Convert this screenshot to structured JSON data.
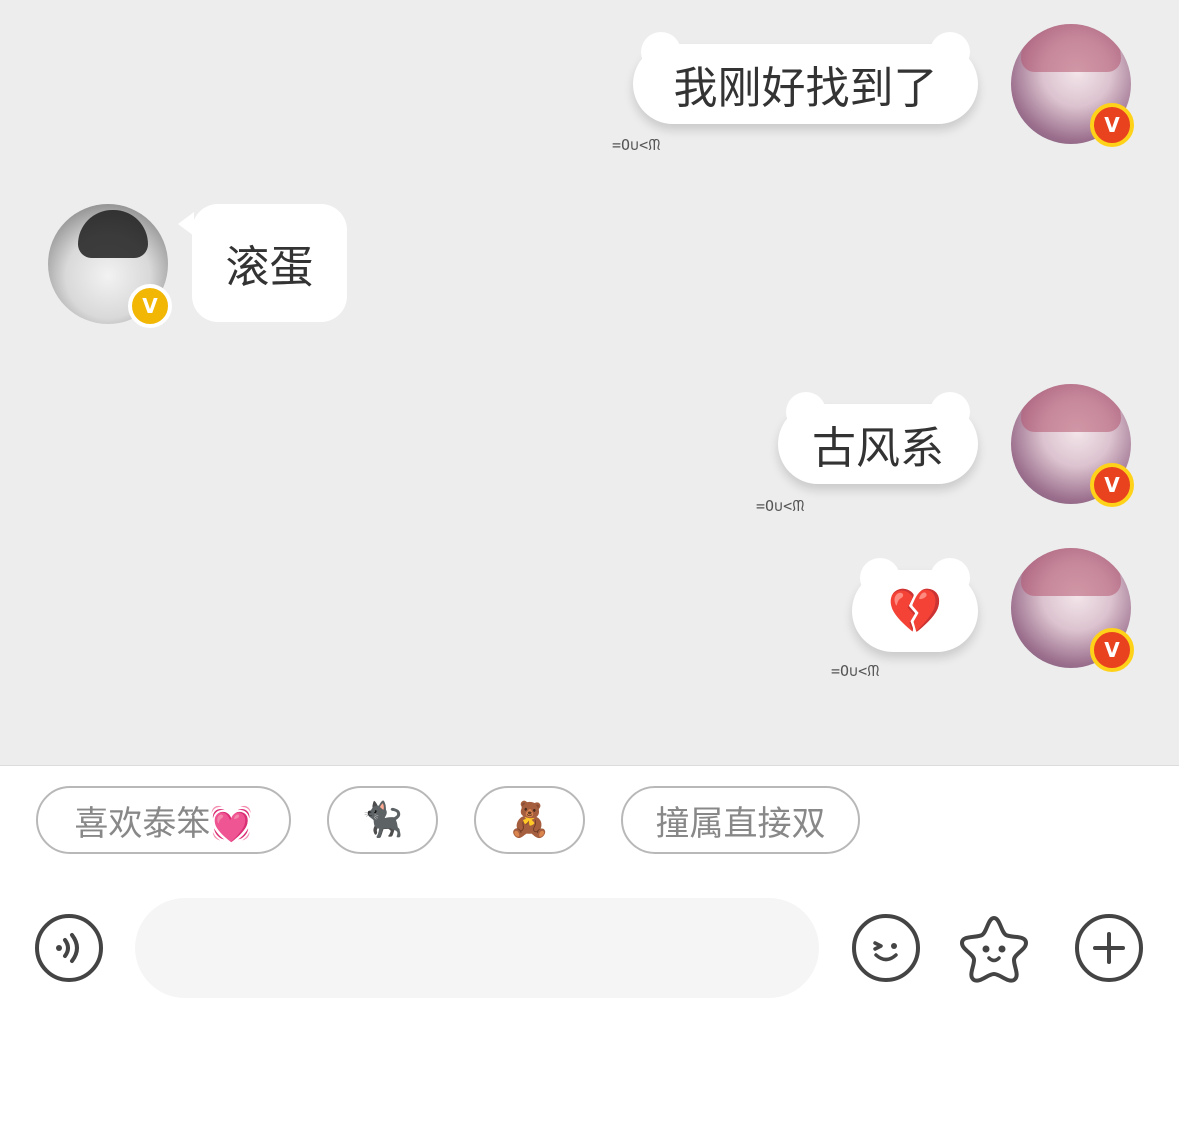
{
  "messages": [
    {
      "text": "我刚好找到了",
      "meta": "=O∪<ᙏ"
    },
    {
      "text": "滚蛋"
    },
    {
      "text": "古风系",
      "meta": "=O∪<ᙏ"
    },
    {
      "text": "💔",
      "meta": "=O∪<ᙏ"
    }
  ],
  "badge_letter": "V",
  "quick_replies": [
    "喜欢泰笨💓",
    "🐈‍⬛",
    "🧸",
    "撞属直接双"
  ],
  "input": {
    "placeholder": ""
  },
  "icons": {
    "voice": "voice-icon",
    "emoji": "emoji-icon",
    "sticker": "star-sticker-icon",
    "more": "plus-icon"
  },
  "colors": {
    "chat_bg": "#ededed",
    "badge_red": "#e8421f",
    "badge_gold": "#f2b705"
  }
}
